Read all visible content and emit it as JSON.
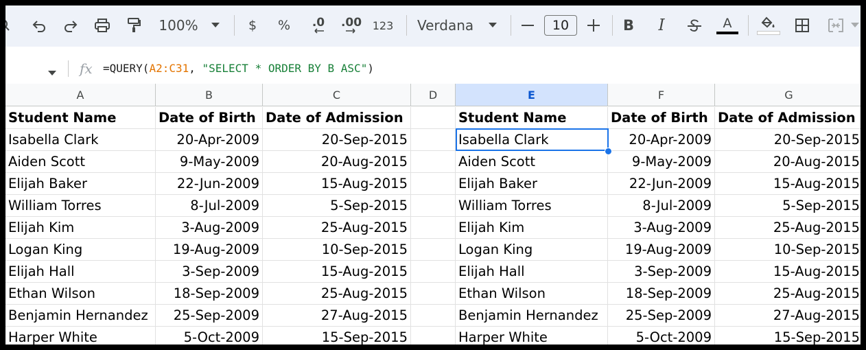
{
  "toolbar": {
    "zoom": "100%",
    "currency": "$",
    "percent": "%",
    "dec_decrease": ".0",
    "dec_increase": ".00",
    "more_formats": "123",
    "font": "Verdana",
    "font_size": "10",
    "bold": "B",
    "italic": "I",
    "text_color_letter": "A"
  },
  "formula_bar": {
    "fx": "fx",
    "prefix": "=QUERY(",
    "range": "A2:C31",
    "sep": ", ",
    "query": "\"SELECT * ORDER BY B ASC\"",
    "suffix": ")"
  },
  "columns": [
    "A",
    "B",
    "C",
    "D",
    "E",
    "F",
    "G"
  ],
  "active_column": "E",
  "headers": [
    "Student Name",
    "Date of Birth",
    "Date of Admission"
  ],
  "rows": [
    [
      "Isabella Clark",
      "20-Apr-2009",
      "20-Sep-2015"
    ],
    [
      "Aiden Scott",
      "9-May-2009",
      "20-Aug-2015"
    ],
    [
      "Elijah Baker",
      "22-Jun-2009",
      "15-Aug-2015"
    ],
    [
      "William Torres",
      "8-Jul-2009",
      "5-Sep-2015"
    ],
    [
      "Elijah Kim",
      "3-Aug-2009",
      "25-Aug-2015"
    ],
    [
      "Logan King",
      "19-Aug-2009",
      "10-Sep-2015"
    ],
    [
      "Elijah Hall",
      "3-Sep-2009",
      "15-Aug-2015"
    ],
    [
      "Ethan Wilson",
      "18-Sep-2009",
      "25-Aug-2015"
    ],
    [
      "Benjamin Hernandez",
      "25-Sep-2009",
      "27-Aug-2015"
    ],
    [
      "Harper White",
      "5-Oct-2009",
      "15-Sep-2015"
    ]
  ],
  "colors": {
    "selection": "#1a73e8",
    "active_header_bg": "#d3e3fd",
    "formula_range": "#e37400",
    "formula_string": "#188038"
  }
}
